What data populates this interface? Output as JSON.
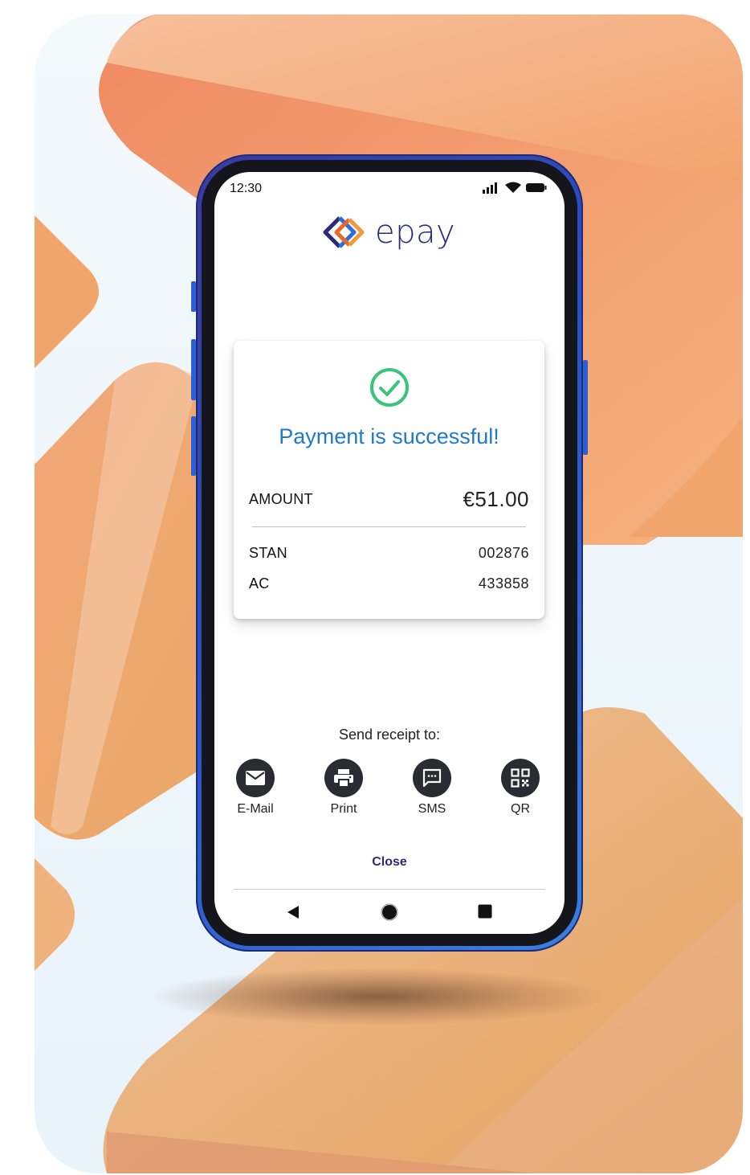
{
  "status_bar": {
    "time": "12:30"
  },
  "brand": {
    "name": "epay",
    "colors": {
      "navy": "#2c2b7a",
      "orange": "#e8672a",
      "blue": "#2d6fd8"
    }
  },
  "result": {
    "icon": "check-circle-icon",
    "message": "Payment is successful!",
    "amount_label": "AMOUNT",
    "amount_value": "€51.00",
    "stan_label": "STAN",
    "stan_value": "002876",
    "ac_label": "AC",
    "ac_value": "433858"
  },
  "receipt": {
    "title": "Send receipt to:",
    "options": [
      {
        "label": "E-Mail",
        "icon": "mail-icon"
      },
      {
        "label": "Print",
        "icon": "printer-icon"
      },
      {
        "label": "SMS",
        "icon": "message-icon"
      },
      {
        "label": "QR",
        "icon": "qr-code-icon"
      }
    ]
  },
  "close_label": "Close",
  "nav_bar": {
    "icons": [
      "back-icon",
      "home-icon",
      "recents-icon"
    ]
  }
}
